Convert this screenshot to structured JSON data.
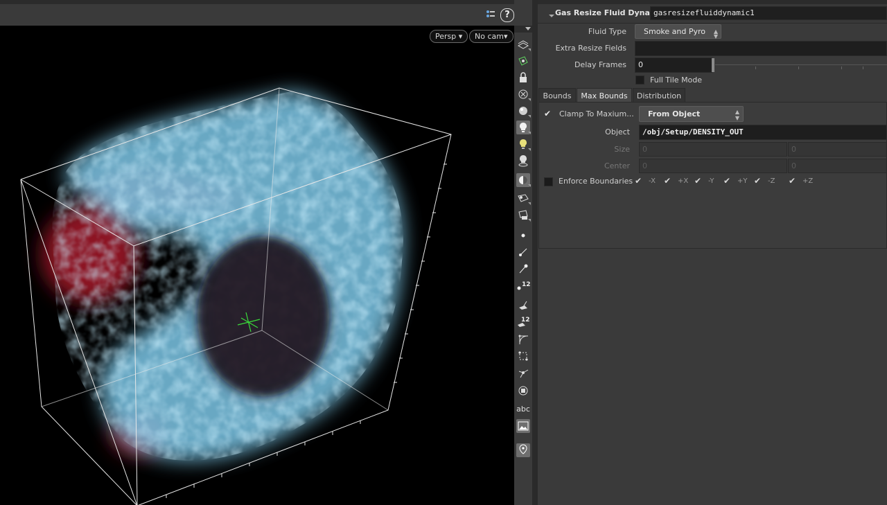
{
  "viewport": {
    "persp_label": "Persp",
    "cam_label": "No cam"
  },
  "node": {
    "type_label": "Gas Resize Fluid Dynamic",
    "name": "gasresizefluiddynamic1"
  },
  "params": {
    "fluid_type": {
      "label": "Fluid Type",
      "value": "Smoke and Pyro"
    },
    "extra_resize_fields": {
      "label": "Extra Resize Fields",
      "value": ""
    },
    "delay_frames": {
      "label": "Delay Frames",
      "value": "0"
    },
    "full_tile_mode": {
      "label": "Full Tile Mode",
      "checked": false
    }
  },
  "tabs": [
    {
      "label": "Bounds",
      "active": false
    },
    {
      "label": "Max Bounds",
      "active": true
    },
    {
      "label": "Distribution",
      "active": false
    }
  ],
  "max_bounds": {
    "clamp": {
      "label": "Clamp To Maxium...",
      "checked": true,
      "value": "From Object"
    },
    "object": {
      "label": "Object",
      "value": "/obj/Setup/DENSITY_OUT"
    },
    "size": {
      "label": "Size",
      "x": "0",
      "y": "0"
    },
    "center": {
      "label": "Center",
      "x": "0",
      "y": "0"
    },
    "enforce": {
      "label": "Enforce Boundaries",
      "checked": false,
      "axes": [
        "-X",
        "+X",
        "-Y",
        "+Y",
        "-Z",
        "+Z"
      ]
    }
  },
  "shelf_text": {
    "label_12a": "12",
    "label_12b": "12",
    "abc": "abc"
  },
  "colors": {
    "viewport_bg": "#000000",
    "pane_bg": "#3a3a3a",
    "smoke_blue": "#8fd3ef",
    "smoke_red": "#c0202a",
    "pivot_green": "#3adb3a"
  }
}
